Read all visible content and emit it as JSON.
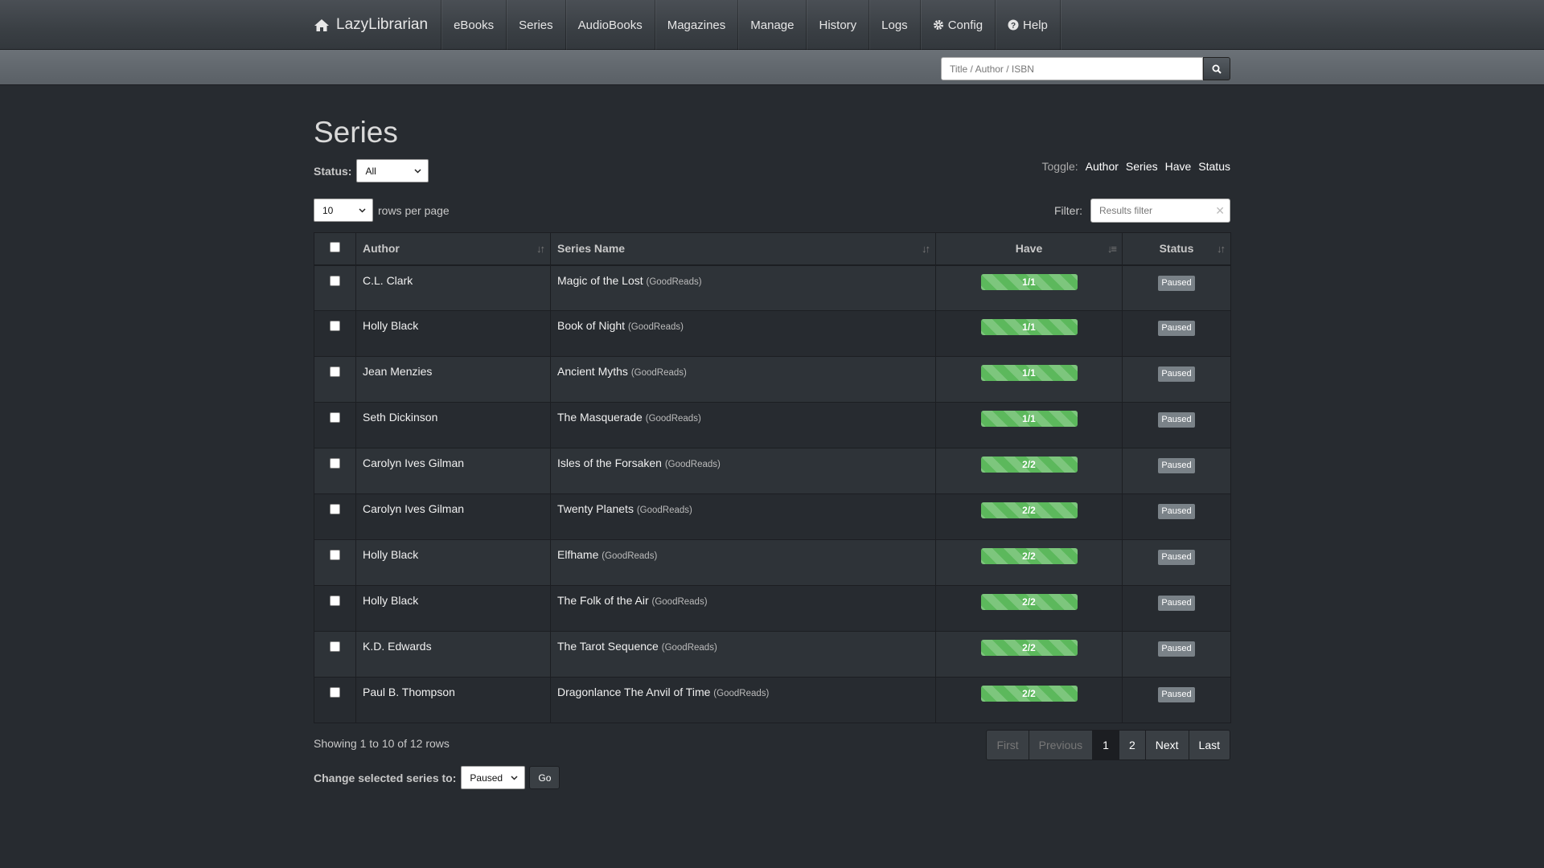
{
  "navbar": {
    "brand": "LazyLibrarian",
    "items": [
      {
        "label": "eBooks"
      },
      {
        "label": "Series"
      },
      {
        "label": "AudioBooks"
      },
      {
        "label": "Magazines"
      },
      {
        "label": "Manage"
      },
      {
        "label": "History"
      },
      {
        "label": "Logs"
      },
      {
        "label": "Config",
        "icon": "gear-icon"
      },
      {
        "label": "Help",
        "icon": "question-circle-icon"
      }
    ]
  },
  "search": {
    "placeholder": "Title / Author / ISBN"
  },
  "page": {
    "title": "Series",
    "status_label": "Status:",
    "status_value": "All",
    "toggle_label": "Toggle:",
    "toggles": [
      "Author",
      "Series",
      "Have",
      "Status"
    ],
    "rows_value": "10",
    "rows_label": "rows per page",
    "filter_label": "Filter:",
    "filter_placeholder": "Results filter"
  },
  "table": {
    "columns": [
      "Author",
      "Series Name",
      "Have",
      "Status"
    ],
    "rows": [
      {
        "author": "C.L. Clark",
        "series": "Magic of the Lost",
        "source": "(GoodReads)",
        "have": "1/1",
        "status": "Paused"
      },
      {
        "author": "Holly Black",
        "series": "Book of Night",
        "source": "(GoodReads)",
        "have": "1/1",
        "status": "Paused"
      },
      {
        "author": "Jean Menzies",
        "series": "Ancient Myths",
        "source": "(GoodReads)",
        "have": "1/1",
        "status": "Paused"
      },
      {
        "author": "Seth Dickinson",
        "series": "The Masquerade",
        "source": "(GoodReads)",
        "have": "1/1",
        "status": "Paused"
      },
      {
        "author": "Carolyn Ives Gilman",
        "series": "Isles of the Forsaken",
        "source": "(GoodReads)",
        "have": "2/2",
        "status": "Paused"
      },
      {
        "author": "Carolyn Ives Gilman",
        "series": "Twenty Planets",
        "source": "(GoodReads)",
        "have": "2/2",
        "status": "Paused"
      },
      {
        "author": "Holly Black",
        "series": "Elfhame",
        "source": "(GoodReads)",
        "have": "2/2",
        "status": "Paused"
      },
      {
        "author": "Holly Black",
        "series": "The Folk of the Air",
        "source": "(GoodReads)",
        "have": "2/2",
        "status": "Paused"
      },
      {
        "author": "K.D. Edwards",
        "series": "The Tarot Sequence",
        "source": "(GoodReads)",
        "have": "2/2",
        "status": "Paused"
      },
      {
        "author": "Paul B. Thompson",
        "series": "Dragonlance The Anvil of Time",
        "source": "(GoodReads)",
        "have": "2/2",
        "status": "Paused"
      }
    ]
  },
  "footer": {
    "showing": "Showing 1 to 10 of 12 rows",
    "pager": {
      "first": "First",
      "previous": "Previous",
      "p1": "1",
      "p2": "2",
      "next": "Next",
      "last": "Last"
    },
    "change_label": "Change selected series to:",
    "change_value": "Paused",
    "go": "Go"
  },
  "colors": {
    "background": "#272b30",
    "progress": "#5cb85c",
    "badge": "#7a8288"
  }
}
